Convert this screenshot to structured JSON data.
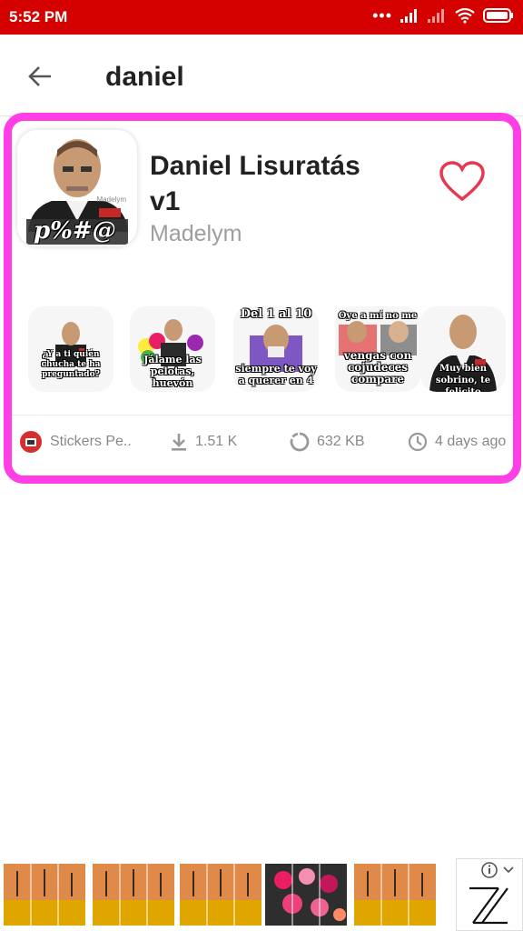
{
  "status_bar": {
    "time": "5:52 PM"
  },
  "header": {
    "query": "daniel"
  },
  "pack": {
    "icon_caption": "p%#@",
    "icon_watermark": "Madelym",
    "title": "Daniel Lisuratás v1",
    "author": "Madelym",
    "stickers": [
      {
        "caption": "¿Y a ti quién chucha te ha preguntado?"
      },
      {
        "caption": "Jálame las pelotas, huevón"
      },
      {
        "top": "Del 1 al 10",
        "caption": "siempre te voy a querer en 4"
      },
      {
        "top": "Oye a mí no me",
        "caption": "vengas con cojudeces compare"
      },
      {
        "caption": "Muy bien sobrino, te felicito"
      }
    ],
    "meta": {
      "publisher": "Stickers Pe..",
      "downloads": "1.51 K",
      "size": "632 KB",
      "updated": "4 days ago"
    }
  },
  "colors": {
    "status": "#d50000",
    "highlight": "#ff3ee6",
    "heart": "#e53950"
  }
}
